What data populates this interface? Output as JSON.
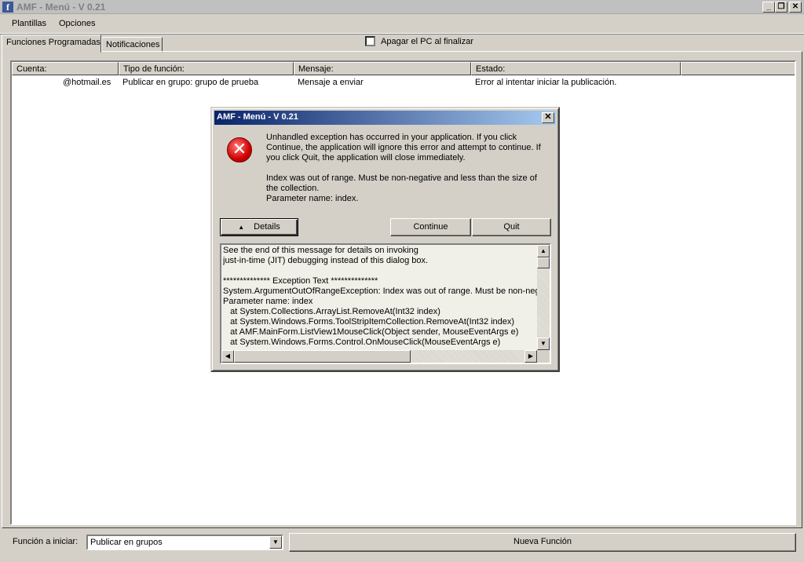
{
  "window": {
    "app_icon": "f",
    "title": "AMF - Menú - V 0.21",
    "controls": {
      "minimize": "_",
      "restore": "❐",
      "close": "✕"
    }
  },
  "menu": [
    "Plantillas",
    "Opciones"
  ],
  "tabs": [
    "Funciones Programadas",
    "Notificaciones"
  ],
  "shutdown_checkbox": {
    "label": "Apagar el PC al finalizar",
    "checked": false
  },
  "list": {
    "columns": [
      "Cuenta:",
      "Tipo de función:",
      "Mensaje:",
      "Estado:"
    ],
    "rows": [
      [
        "@hotmail.es",
        "Publicar en grupo: grupo de prueba",
        "Mensaje a enviar",
        "Error al intentar iniciar la publicación."
      ]
    ]
  },
  "dialog": {
    "title": "AMF - Menú - V 0.21",
    "close": "✕",
    "icon": "error-x-icon",
    "message_1": "Unhandled exception has occurred in your application. If you click\nContinue, the application will ignore this error and attempt to continue. If\nyou click Quit, the application will close immediately.",
    "message_2": "Index was out of range. Must be non-negative and less than the size of\nthe collection.\nParameter name: index.",
    "details_button": "Details",
    "continue_button": "Continue",
    "quit_button": "Quit",
    "details_text": "See the end of this message for details on invoking\njust-in-time (JIT) debugging instead of this dialog box.\n\n************** Exception Text **************\nSystem.ArgumentOutOfRangeException: Index was out of range. Must be non-negati\nParameter name: index\n   at System.Collections.ArrayList.RemoveAt(Int32 index)\n   at System.Windows.Forms.ToolStripItemCollection.RemoveAt(Int32 index)\n   at AMF.MainForm.ListView1MouseClick(Object sender, MouseEventArgs e)\n   at System.Windows.Forms.Control.OnMouseClick(MouseEventArgs e)"
  },
  "bottom": {
    "function_label": "Función a iniciar:",
    "function_value": "Publicar en grupos",
    "new_function_button": "Nueva Función"
  }
}
